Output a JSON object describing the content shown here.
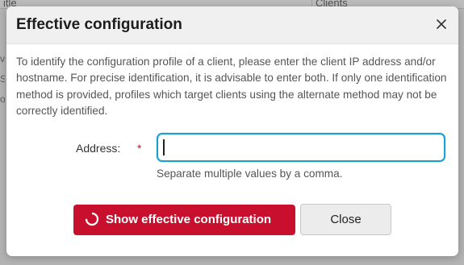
{
  "background": {
    "column_1_header": "itle",
    "column_2_header": "Clients",
    "edge_chars": [
      "v",
      "S",
      "o"
    ]
  },
  "dialog": {
    "title": "Effective configuration",
    "close_icon": "close-icon",
    "description": "To identify the configuration profile of a client, please enter the client IP address and/or hostname. For precise identification, it is advisable to enter both. If only one identification method is provided, profiles which target clients using the alternate method may not be correctly identified.",
    "address_field": {
      "label": "Address:",
      "required_marker": "*",
      "value": "",
      "placeholder": "",
      "helper": "Separate multiple values by a comma."
    },
    "buttons": {
      "primary_label": "Show effective configuration",
      "primary_icon": "loading-spinner-icon",
      "secondary_label": "Close"
    }
  },
  "colors": {
    "accent_red": "#c8102e",
    "focus_blue": "#1a9fd0",
    "header_bg": "#f0f0f0"
  }
}
